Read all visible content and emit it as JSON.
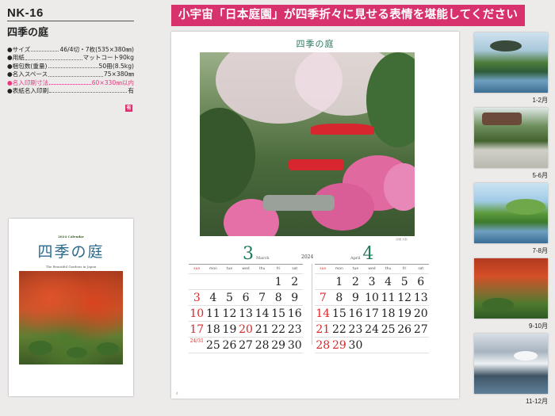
{
  "product": {
    "code": "NK-16",
    "name": "四季の庭",
    "specs": [
      {
        "label": "●サイズ",
        "value": "46/4切・7枚(535×380㎜)",
        "highlight": false
      },
      {
        "label": "●用紙",
        "value": "マットコート90kg",
        "highlight": false
      },
      {
        "label": "●梱包数(重量)",
        "value": "50冊(8.5kg)",
        "highlight": false
      },
      {
        "label": "●名入スペース",
        "value": "75×380㎜",
        "highlight": false
      },
      {
        "label": "●名入印刷寸法",
        "value": "60×330㎜以内",
        "highlight": true
      },
      {
        "label": "●表紙名入印刷",
        "value": "有",
        "highlight": false
      }
    ],
    "badge": "有"
  },
  "cover": {
    "year_label": "2024 Calendar",
    "title": "四季の庭",
    "subtitle": "The Beautiful Gardens in Japan"
  },
  "banner": "小宇宙「日本庭園」が四季折々に見せる表情を堪能してください",
  "page": {
    "title": "四季の庭",
    "credit": "(京都 大原)",
    "year": "2024",
    "left_month": {
      "number": "3",
      "name": "March"
    },
    "right_month": {
      "number": "4",
      "name": "April"
    },
    "weekdays": [
      "sun",
      "mon",
      "tue",
      "wed",
      "thu",
      "fri",
      "sat"
    ],
    "march": [
      [
        "",
        "",
        "",
        "",
        "",
        "1",
        "2"
      ],
      [
        "3",
        "4",
        "5",
        "6",
        "7",
        "8",
        "9"
      ],
      [
        "10",
        "11",
        "12",
        "13",
        "14",
        "15",
        "16"
      ],
      [
        "17",
        "18",
        "19",
        "20",
        "21",
        "22",
        "23"
      ],
      [
        "24/31",
        "25",
        "26",
        "27",
        "28",
        "29",
        "30"
      ]
    ],
    "april": [
      [
        "",
        "1",
        "2",
        "3",
        "4",
        "5",
        "6"
      ],
      [
        "7",
        "8",
        "9",
        "10",
        "11",
        "12",
        "13"
      ],
      [
        "14",
        "15",
        "16",
        "17",
        "18",
        "19",
        "20"
      ],
      [
        "21",
        "22",
        "23",
        "24",
        "25",
        "26",
        "27"
      ],
      [
        "28",
        "29",
        "30",
        "",
        "",
        "",
        ""
      ]
    ],
    "march_holidays": [
      "20"
    ],
    "april_holidays": [
      "29"
    ],
    "foot": "4"
  },
  "thumbnails": [
    {
      "label": "1-2月"
    },
    {
      "label": "5-6月"
    },
    {
      "label": "7-8月"
    },
    {
      "label": "9-10月"
    },
    {
      "label": "11-12月"
    }
  ],
  "colors": {
    "accent": "#d8326e",
    "title_green": "#2a7a5a",
    "sunday_red": "#d62a2a"
  }
}
